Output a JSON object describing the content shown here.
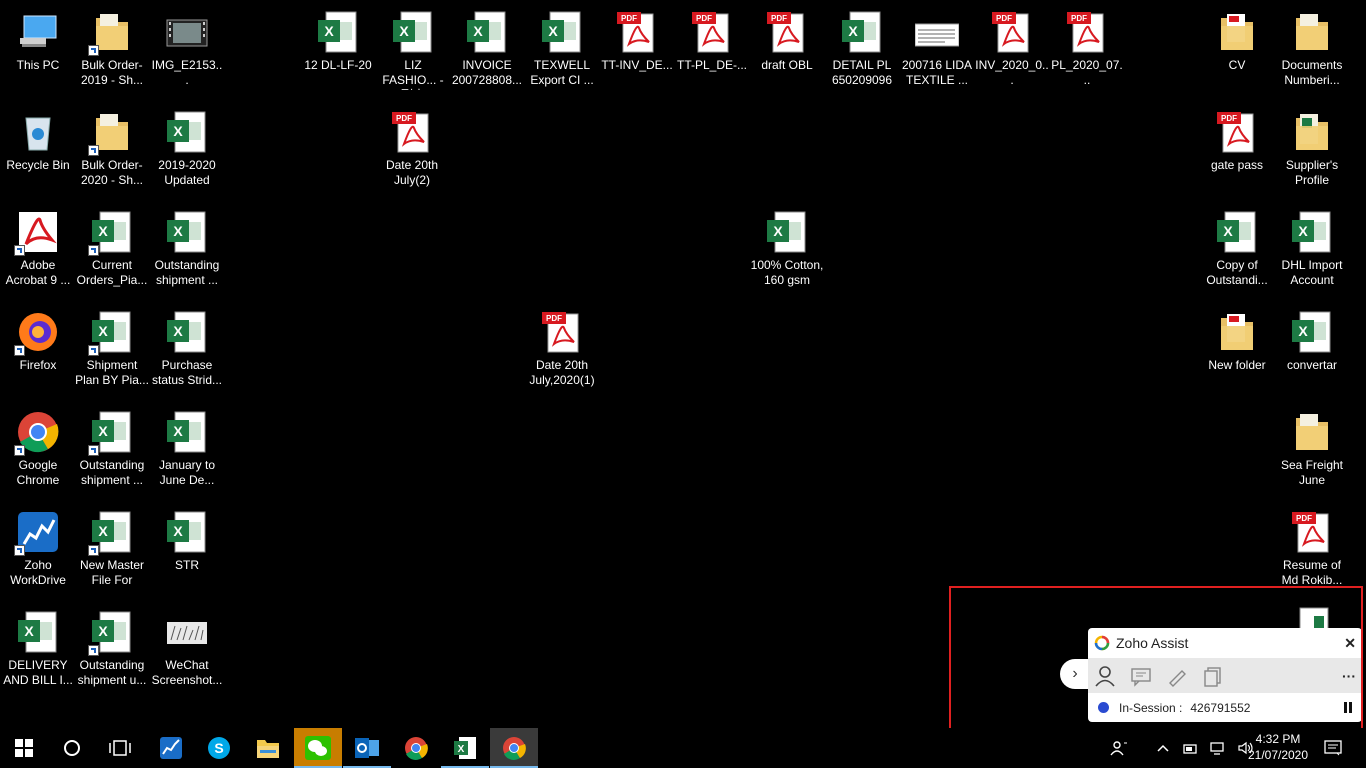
{
  "desktop": {
    "left_columns": [
      [
        "This PC",
        "Recycle Bin",
        "Adobe Acrobat 9 ...",
        "Firefox",
        "Google Chrome",
        "Zoho WorkDrive",
        "DELIVERY AND BILL I..."
      ],
      [
        "Bulk Order-2019 - Sh...",
        "Bulk Order-2020 - Sh...",
        "Current Orders_Pia...",
        "Shipment Plan BY Pia...",
        "Outstanding shipment ...",
        "New Master File For Dec...",
        "Outstanding shipment u..."
      ],
      [
        "IMG_E2153...",
        "2019-2020 Updated",
        "Outstanding shipment ...",
        "Purchase status Strid...",
        "January to June De...",
        "STR",
        "WeChat Screenshot..."
      ]
    ],
    "top_row": [
      "12 DL-LF-20",
      "LIZ FASHIO... - 副本",
      "INVOICE 200728808...",
      "TEXWELL Export CI ...",
      "TT-INV_DE...",
      "TT-PL_DE-...",
      "draft OBL",
      "DETAIL PL 650209096",
      "200716 LIDA TEXTILE ...",
      "INV_2020_0...",
      "PL_2020_07..."
    ],
    "scattered": [
      "Date 20th July(2)",
      "Date 20th July,2020(1)",
      "100% Cotton, 160 gsm"
    ],
    "right_columns": [
      [
        "CV",
        "gate pass",
        "Copy of Outstandi...",
        "New folder"
      ],
      [
        "Documents Numberi...",
        "Supplier's Profile",
        "DHL Import Account",
        "convertar",
        "Sea Freight June",
        "Resume of Md Rokib..."
      ]
    ]
  },
  "zoho_assist": {
    "title": "Zoho Assist",
    "close": "✕",
    "more": "···",
    "status_label": "In-Session :",
    "session_id": "426791552",
    "toggle": "›"
  },
  "taskbar": {
    "time": "4:32 PM",
    "date": "21/07/2020"
  },
  "colors": {
    "highlight": "#e02020",
    "excel": "#1d7a44",
    "pdf": "#d71920"
  }
}
